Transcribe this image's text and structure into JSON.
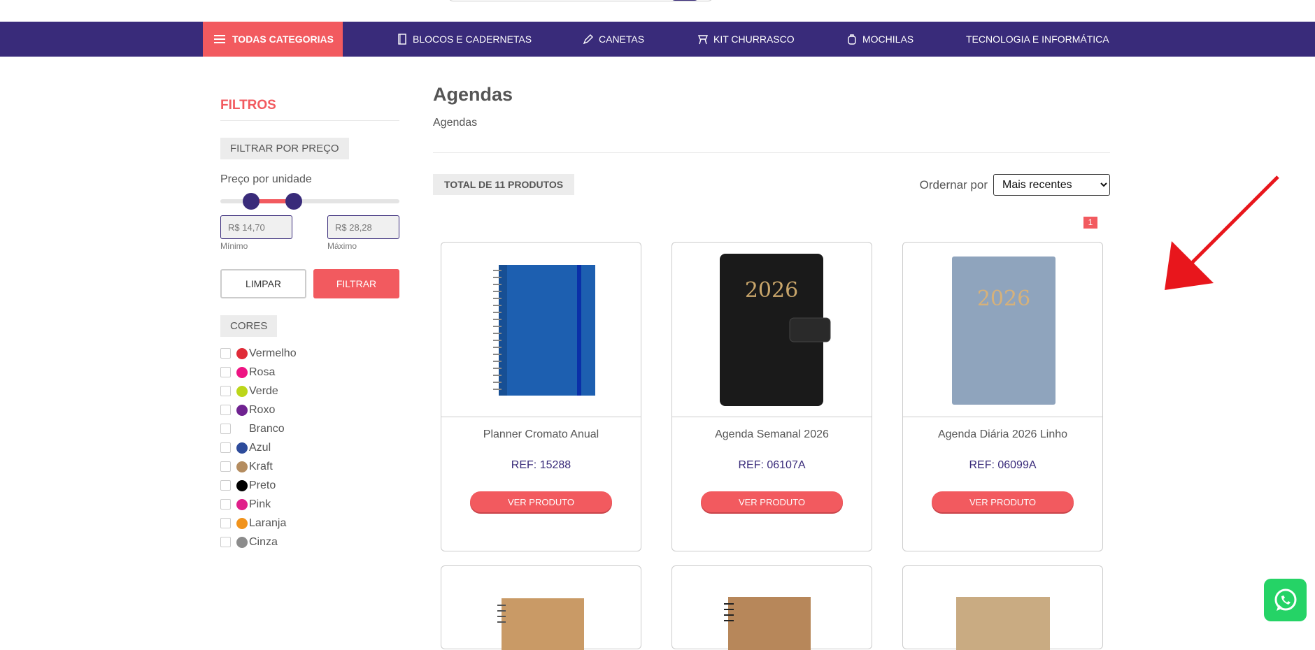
{
  "nav": {
    "all_categories": "TODAS CATEGORIAS",
    "items": [
      {
        "label": "BLOCOS E CADERNETAS",
        "icon": "notebook-icon"
      },
      {
        "label": "CANETAS",
        "icon": "pen-icon"
      },
      {
        "label": "KIT CHURRASCO",
        "icon": "grill-icon"
      },
      {
        "label": "MOCHILAS",
        "icon": "backpack-icon"
      },
      {
        "label": "TECNOLOGIA E INFORMÁTICA",
        "icon": ""
      }
    ]
  },
  "sidebar": {
    "title": "FILTROS",
    "price_filter_tag": "FILTRAR POR PREÇO",
    "price_label": "Preço por unidade",
    "min_value": "R$ 14,70",
    "max_value": "R$ 28,28",
    "min_label": "Mínimo",
    "max_label": "Máximo",
    "clear_label": "LIMPAR",
    "filter_label": "FILTRAR",
    "colors_tag": "CORES",
    "colors": [
      {
        "name": "Vermelho",
        "hex": "#e02b38"
      },
      {
        "name": "Rosa",
        "hex": "#ee1483"
      },
      {
        "name": "Verde",
        "hex": "#bcd61a"
      },
      {
        "name": "Roxo",
        "hex": "#6f2290"
      },
      {
        "name": "Branco",
        "hex": "#ffffff"
      },
      {
        "name": "Azul",
        "hex": "#2d4b9b"
      },
      {
        "name": "Kraft",
        "hex": "#b48c5f"
      },
      {
        "name": "Preto",
        "hex": "#000000"
      },
      {
        "name": "Pink",
        "hex": "#e0208a"
      },
      {
        "name": "Laranja",
        "hex": "#f1931c"
      },
      {
        "name": "Cinza",
        "hex": "#8c8c8c"
      }
    ]
  },
  "main": {
    "title": "Agendas",
    "breadcrumb": "Agendas",
    "total": "TOTAL DE 11 PRODUTOS",
    "sort_label": "Ordernar por",
    "sort_selected": "Mais recentes",
    "page": "1",
    "products": [
      {
        "name": "Planner Cromato Anual",
        "ref": "REF: 15288",
        "button": "VER PRODUTO",
        "cover_text": ""
      },
      {
        "name": "Agenda Semanal 2026",
        "ref": "REF: 06107A",
        "button": "VER PRODUTO",
        "cover_text": "2026"
      },
      {
        "name": "Agenda Diária 2026 Linho",
        "ref": "REF: 06099A",
        "button": "VER PRODUTO",
        "cover_text": "2026"
      }
    ]
  },
  "colors": {
    "primary": "#392b7a",
    "accent": "#f25a5f",
    "whatsapp": "#25d366",
    "arrow": "#e8161c"
  }
}
